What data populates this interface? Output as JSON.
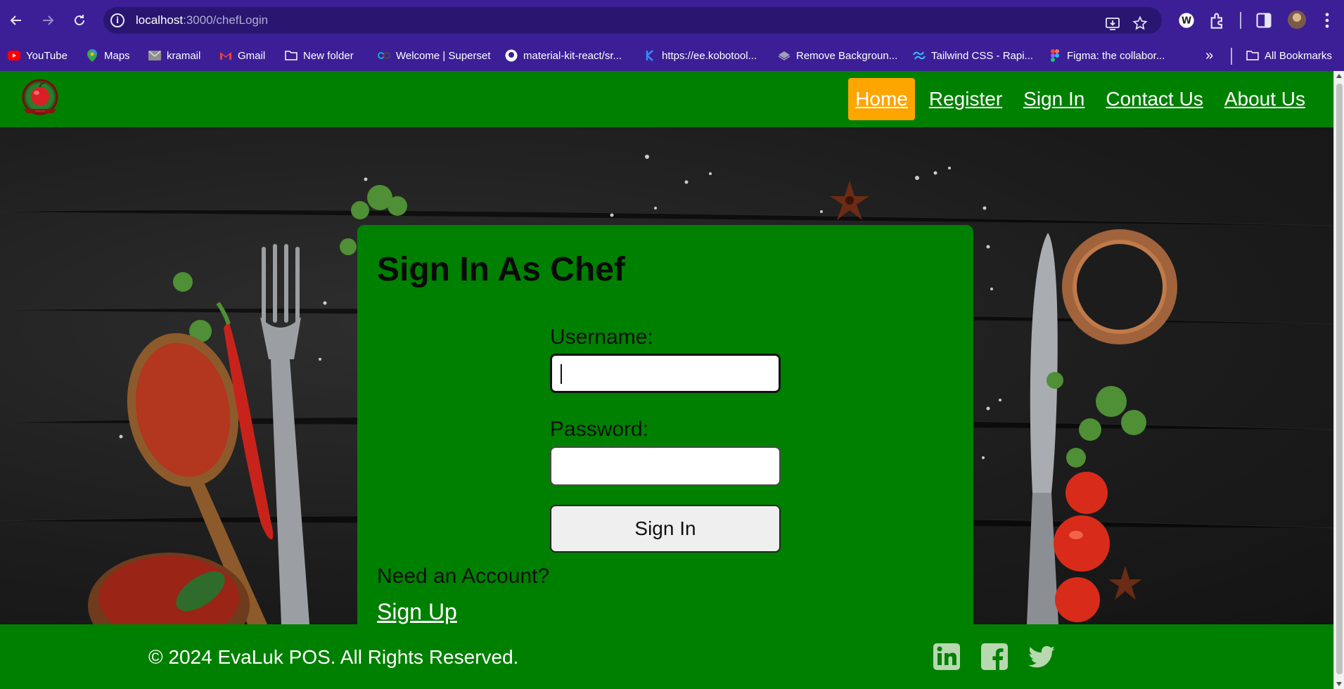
{
  "browser": {
    "url_host": "localhost",
    "url_path": ":3000/chefLogin",
    "bookmarks": [
      {
        "label": "YouTube",
        "icon": "youtube-icon",
        "color": "#ff0000"
      },
      {
        "label": "Maps",
        "icon": "maps-icon",
        "color": "#34a853"
      },
      {
        "label": "kramail",
        "icon": "mail-icon",
        "color": "#8e8e8e"
      },
      {
        "label": "Gmail",
        "icon": "gmail-icon",
        "color": "#ea4335"
      },
      {
        "label": "New folder",
        "icon": "folder-icon",
        "color": "#ffffff"
      },
      {
        "label": "Welcome | Superset",
        "icon": "superset-icon",
        "color": "#20a7c9"
      },
      {
        "label": "material-kit-react/sr...",
        "icon": "github-icon",
        "color": "#ffffff"
      },
      {
        "label": "https://ee.kobotool...",
        "icon": "kobo-icon",
        "color": "#2f8ef4"
      },
      {
        "label": "Remove Backgroun...",
        "icon": "removebg-icon",
        "color": "#a0a0b8"
      },
      {
        "label": "Tailwind CSS - Rapi...",
        "icon": "tailwind-icon",
        "color": "#38bdf8"
      },
      {
        "label": "Figma: the collabor...",
        "icon": "figma-icon",
        "color": "#f24e1e"
      }
    ],
    "all_bookmarks": "All Bookmarks",
    "more": "»"
  },
  "header": {
    "logo": "apple-logo",
    "nav": [
      {
        "label": "Home",
        "active": true
      },
      {
        "label": "Register",
        "active": false
      },
      {
        "label": "Sign In",
        "active": false
      },
      {
        "label": "Contact Us",
        "active": false
      },
      {
        "label": "About Us",
        "active": false
      }
    ],
    "active_color": "#ffa500",
    "brand_color": "#008000"
  },
  "form": {
    "title": "Sign In As Chef",
    "username_label": "Username:",
    "username_value": "",
    "password_label": "Password:",
    "password_value": "",
    "submit_label": "Sign In",
    "need_account": "Need an Account?",
    "signup_label": "Sign Up"
  },
  "footer": {
    "copyright": "© 2024 EvaLuk POS. All Rights Reserved.",
    "social": [
      "linkedin-icon",
      "facebook-icon",
      "twitter-icon"
    ]
  }
}
